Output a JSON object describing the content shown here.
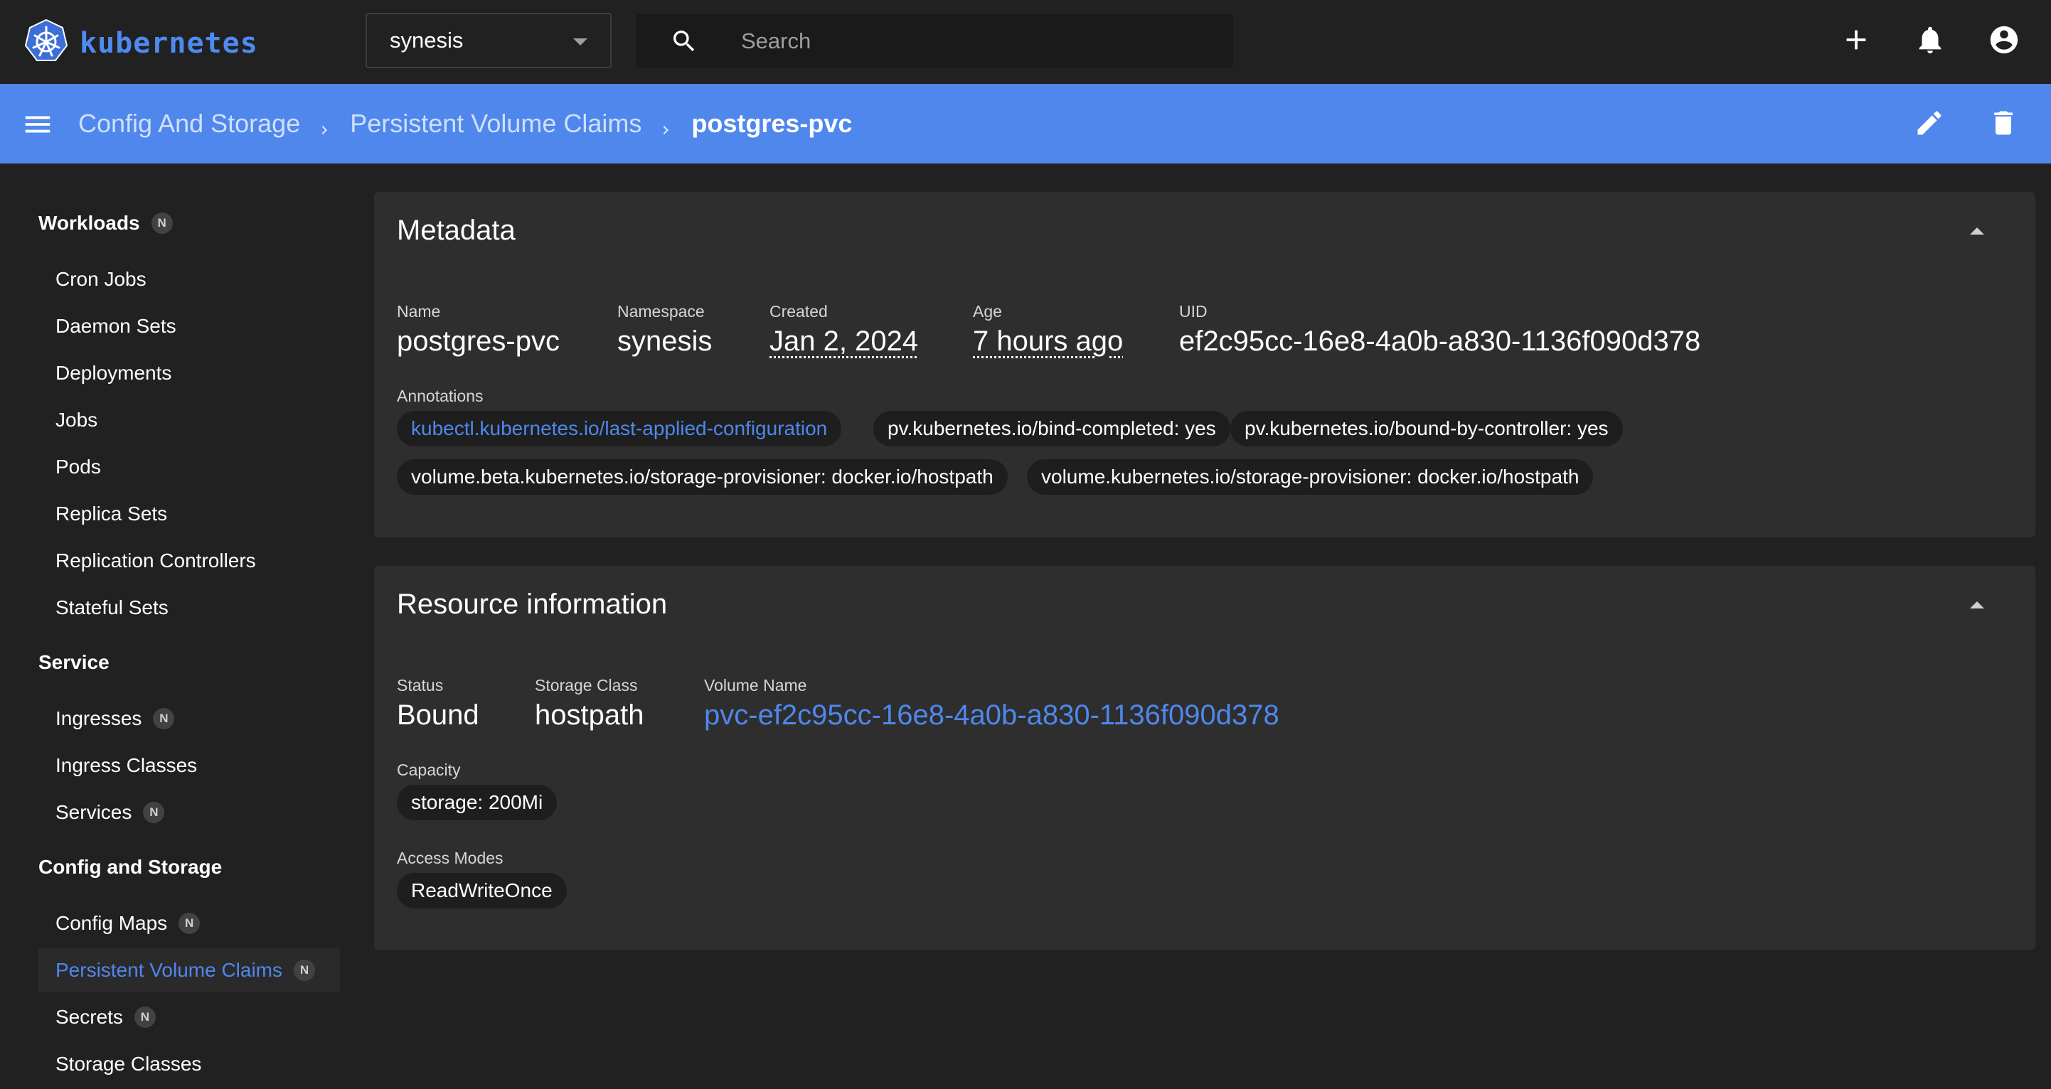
{
  "header": {
    "logo_text": "kubernetes",
    "namespace": "synesis",
    "search_placeholder": "Search",
    "icons": [
      "kubernetes-logo-icon",
      "dropdown-caret-icon",
      "search-icon",
      "plus-icon",
      "bell-icon",
      "account-circle-icon"
    ]
  },
  "toolbar": {
    "breadcrumbs": [
      "Config And Storage",
      "Persistent Volume Claims"
    ],
    "current": "postgres-pvc",
    "icons": [
      "menu-icon",
      "chevron-right-icon",
      "edit-icon",
      "delete-icon"
    ]
  },
  "sidebar": {
    "workloads": {
      "title": "Workloads",
      "badge": "N",
      "items": [
        {
          "label": "Cron Jobs"
        },
        {
          "label": "Daemon Sets"
        },
        {
          "label": "Deployments"
        },
        {
          "label": "Jobs"
        },
        {
          "label": "Pods"
        },
        {
          "label": "Replica Sets"
        },
        {
          "label": "Replication Controllers"
        },
        {
          "label": "Stateful Sets"
        }
      ]
    },
    "service": {
      "title": "Service",
      "items": [
        {
          "label": "Ingresses",
          "badge": "N"
        },
        {
          "label": "Ingress Classes"
        },
        {
          "label": "Services",
          "badge": "N"
        }
      ]
    },
    "config": {
      "title": "Config and Storage",
      "items": [
        {
          "label": "Config Maps",
          "badge": "N"
        },
        {
          "label": "Persistent Volume Claims",
          "badge": "N",
          "active": true
        },
        {
          "label": "Secrets",
          "badge": "N"
        },
        {
          "label": "Storage Classes"
        }
      ]
    }
  },
  "metadata": {
    "title": "Metadata",
    "name_label": "Name",
    "name": "postgres-pvc",
    "namespace_label": "Namespace",
    "namespace": "synesis",
    "created_label": "Created",
    "created": "Jan 2, 2024",
    "age_label": "Age",
    "age": "7 hours ago",
    "uid_label": "UID",
    "uid": "ef2c95cc-16e8-4a0b-a830-1136f090d378",
    "annotations_label": "Annotations",
    "annotations": [
      "kubectl.kubernetes.io/last-applied-configuration",
      "pv.kubernetes.io/bind-completed: yes",
      "pv.kubernetes.io/bound-by-controller: yes",
      "volume.beta.kubernetes.io/storage-provisioner: docker.io/hostpath",
      "volume.kubernetes.io/storage-provisioner: docker.io/hostpath"
    ]
  },
  "resource": {
    "title": "Resource information",
    "status_label": "Status",
    "status": "Bound",
    "storage_class_label": "Storage Class",
    "storage_class": "hostpath",
    "volume_name_label": "Volume Name",
    "volume_name": "pvc-ef2c95cc-16e8-4a0b-a830-1136f090d378",
    "capacity_label": "Capacity",
    "capacity": "storage: 200Mi",
    "access_modes_label": "Access Modes",
    "access_mode": "ReadWriteOnce"
  },
  "colors": {
    "accent": "#4f87ec",
    "background": "#212121",
    "card": "#2e2e2e",
    "chip": "#1e1e1e",
    "badge": "#424242"
  }
}
